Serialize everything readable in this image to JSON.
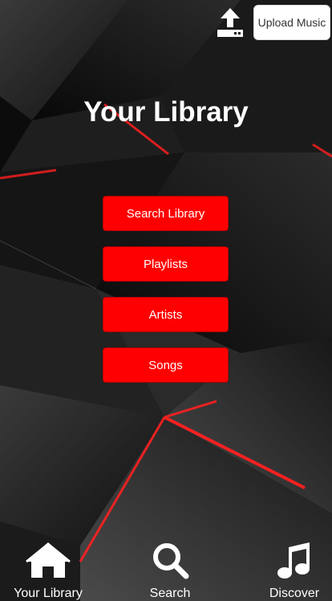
{
  "header": {
    "upload_icon": "upload-tray-icon",
    "upload_label": "Upload Music"
  },
  "page": {
    "title": "Your Library"
  },
  "menu": {
    "items": [
      {
        "label": "Search Library"
      },
      {
        "label": "Playlists"
      },
      {
        "label": "Artists"
      },
      {
        "label": "Songs"
      }
    ]
  },
  "bottom_nav": {
    "items": [
      {
        "label": "Your Library",
        "icon": "home-icon"
      },
      {
        "label": "Search",
        "icon": "search-icon"
      },
      {
        "label": "Discover",
        "icon": "music-note-icon"
      }
    ]
  },
  "colors": {
    "accent": "#ff0000",
    "background": "#111111",
    "text": "#ffffff"
  }
}
